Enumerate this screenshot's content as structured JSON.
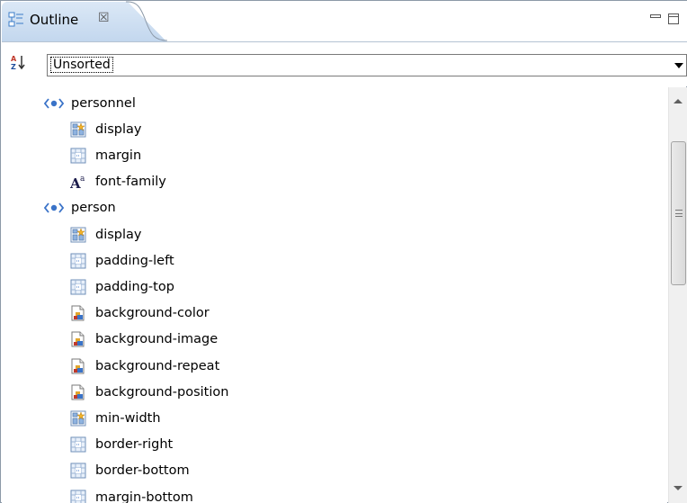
{
  "tab": {
    "label": "Outline",
    "close_glyph": "☒",
    "icon": "outline-icon"
  },
  "toolbar": {
    "sort_icon": "sort-az-icon",
    "sort_select": {
      "selected": "Unsorted"
    }
  },
  "tree": {
    "items": [
      {
        "label": "personnel",
        "icon": "element-icon",
        "level": 0
      },
      {
        "label": "display",
        "icon": "display-property-icon",
        "level": 1
      },
      {
        "label": "margin",
        "icon": "box-property-icon",
        "level": 1
      },
      {
        "label": "font-family",
        "icon": "font-property-icon",
        "level": 1
      },
      {
        "label": "person",
        "icon": "element-icon",
        "level": 0
      },
      {
        "label": "display",
        "icon": "display-property-icon",
        "level": 1
      },
      {
        "label": "padding-left",
        "icon": "box-property-icon",
        "level": 1
      },
      {
        "label": "padding-top",
        "icon": "box-property-icon",
        "level": 1
      },
      {
        "label": "background-color",
        "icon": "background-property-icon",
        "level": 1
      },
      {
        "label": "background-image",
        "icon": "background-property-icon",
        "level": 1
      },
      {
        "label": "background-repeat",
        "icon": "background-property-icon",
        "level": 1
      },
      {
        "label": "background-position",
        "icon": "background-property-icon",
        "level": 1
      },
      {
        "label": "min-width",
        "icon": "display-property-icon",
        "level": 1
      },
      {
        "label": "border-right",
        "icon": "box-property-icon",
        "level": 1
      },
      {
        "label": "border-bottom",
        "icon": "box-property-icon",
        "level": 1
      },
      {
        "label": "margin-bottom",
        "icon": "box-property-icon",
        "level": 1
      }
    ]
  },
  "colors": {
    "tab_gradient_top": "#dbe8f6",
    "tab_gradient_bottom": "#c3d7ee",
    "element_icon": "#3a73c8",
    "border": "#8c99a8"
  }
}
